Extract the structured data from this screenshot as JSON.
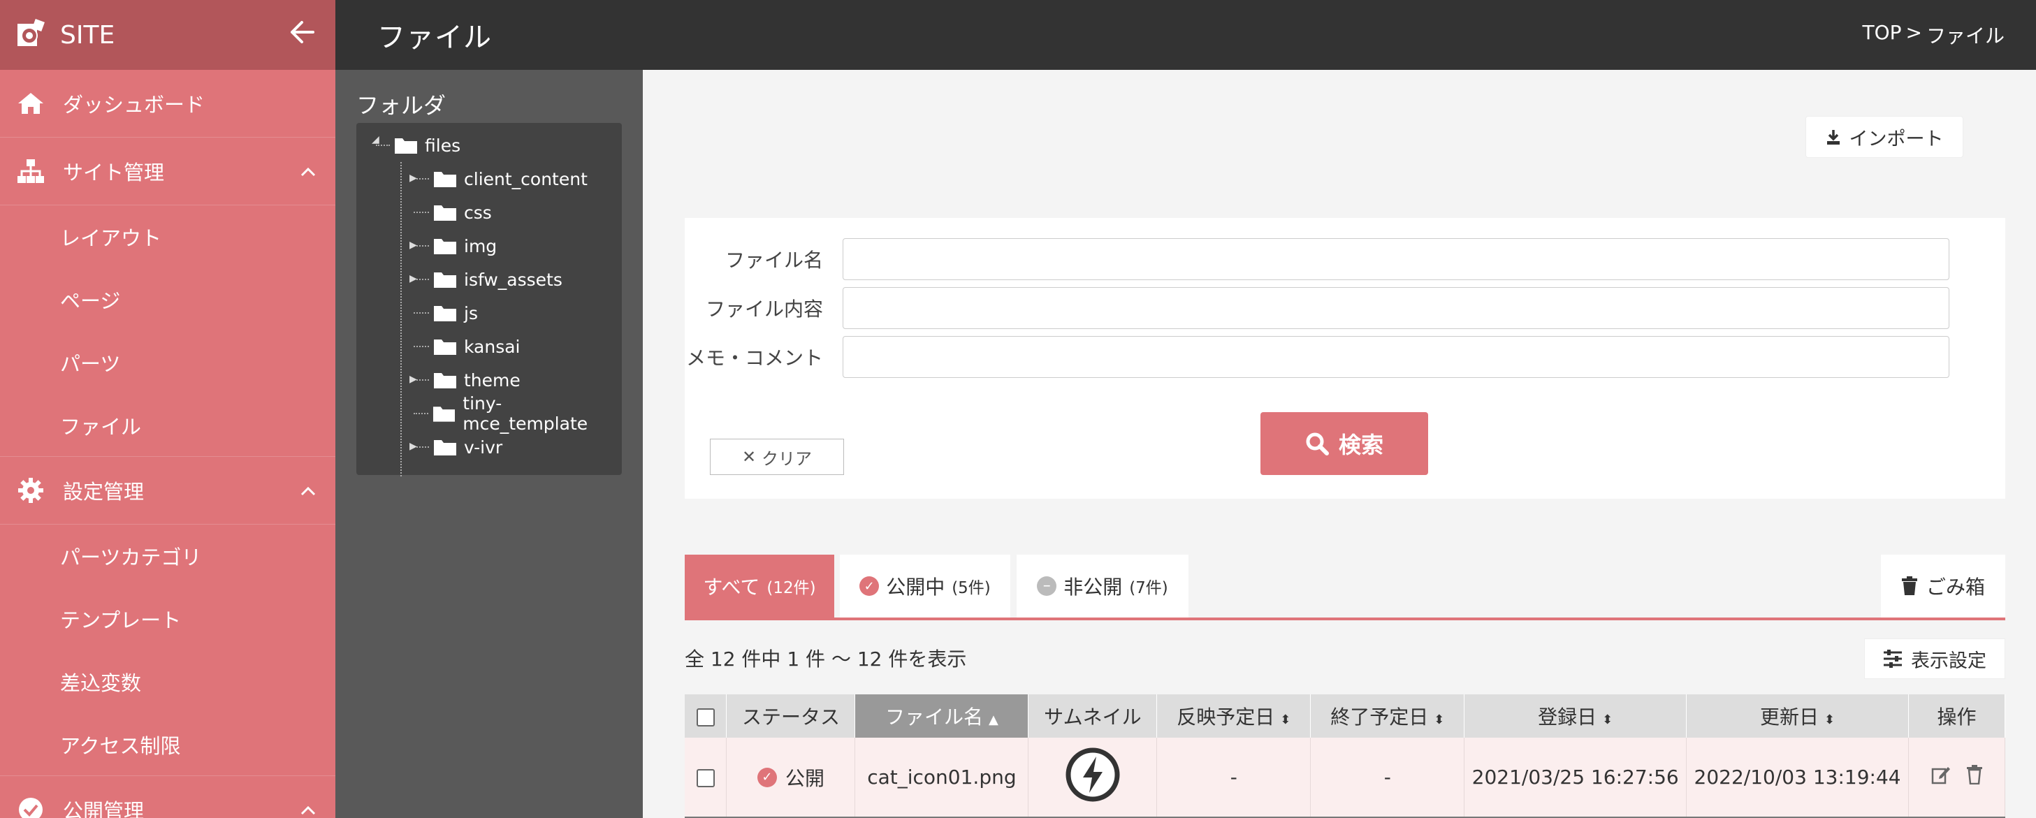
{
  "colors": {
    "accent": "#df7479",
    "sidebar": "#df7479",
    "sidebar_top": "#b2565a",
    "header": "#333333",
    "folder_panel": "#595959"
  },
  "sidebar": {
    "site_name": "SITE",
    "back_icon": "arrow-left-icon",
    "sections": [
      {
        "icon": "home-icon",
        "label": "ダッシュボード",
        "items": []
      },
      {
        "icon": "sitemap-icon",
        "label": "サイト管理",
        "expanded": true,
        "items": [
          "レイアウト",
          "ページ",
          "パーツ",
          "ファイル"
        ]
      },
      {
        "icon": "gear-icon",
        "label": "設定管理",
        "expanded": true,
        "items": [
          "パーツカテゴリ",
          "テンプレート",
          "差込変数",
          "アクセス制限"
        ]
      },
      {
        "icon": "check-circle-icon",
        "label": "公開管理",
        "expanded": true,
        "items": []
      }
    ]
  },
  "header": {
    "title": "ファイル",
    "breadcrumb": [
      "TOP",
      ">",
      "ファイル"
    ]
  },
  "folder_panel": {
    "title": "フォルダ",
    "root": "files",
    "children": [
      "client_content",
      "css",
      "img",
      "isfw_assets",
      "js",
      "kansai",
      "theme",
      "tiny-mce_template",
      "v-ivr"
    ],
    "expandable": [
      "client_content",
      "img",
      "isfw_assets",
      "theme",
      "v-ivr"
    ]
  },
  "import_button": "インポート",
  "search": {
    "fields": [
      {
        "label": "ファイル名",
        "value": "",
        "placeholder": ""
      },
      {
        "label": "ファイル内容",
        "value": "",
        "placeholder": ""
      },
      {
        "label": "メモ・コメント",
        "value": "",
        "placeholder": ""
      }
    ],
    "clear_label": "クリア",
    "search_label": "検索"
  },
  "tabs": [
    {
      "label": "すべて",
      "count": "(12件)",
      "active": true
    },
    {
      "label": "公開中",
      "count": "(5件)",
      "icon": "check-circle-icon"
    },
    {
      "label": "非公開",
      "count": "(7件)",
      "icon": "minus-circle-icon"
    }
  ],
  "trash_label": "ごみ箱",
  "result_count": "全 12 件中 1 件 〜 12 件を表示",
  "display_settings_label": "表示設定",
  "table": {
    "columns": [
      "ステータス",
      "ファイル名",
      "サムネイル",
      "反映予定日",
      "終了予定日",
      "登録日",
      "更新日",
      "操作"
    ],
    "sorted_column": "ファイル名",
    "rows": [
      {
        "status": "公開",
        "filename": "cat_icon01.png",
        "thumbnail_icon": "lightning-bolt-icon",
        "publish_date": "-",
        "end_date": "-",
        "registered": "2021/03/25 16:27:56",
        "updated": "2022/10/03 13:19:44"
      }
    ]
  }
}
